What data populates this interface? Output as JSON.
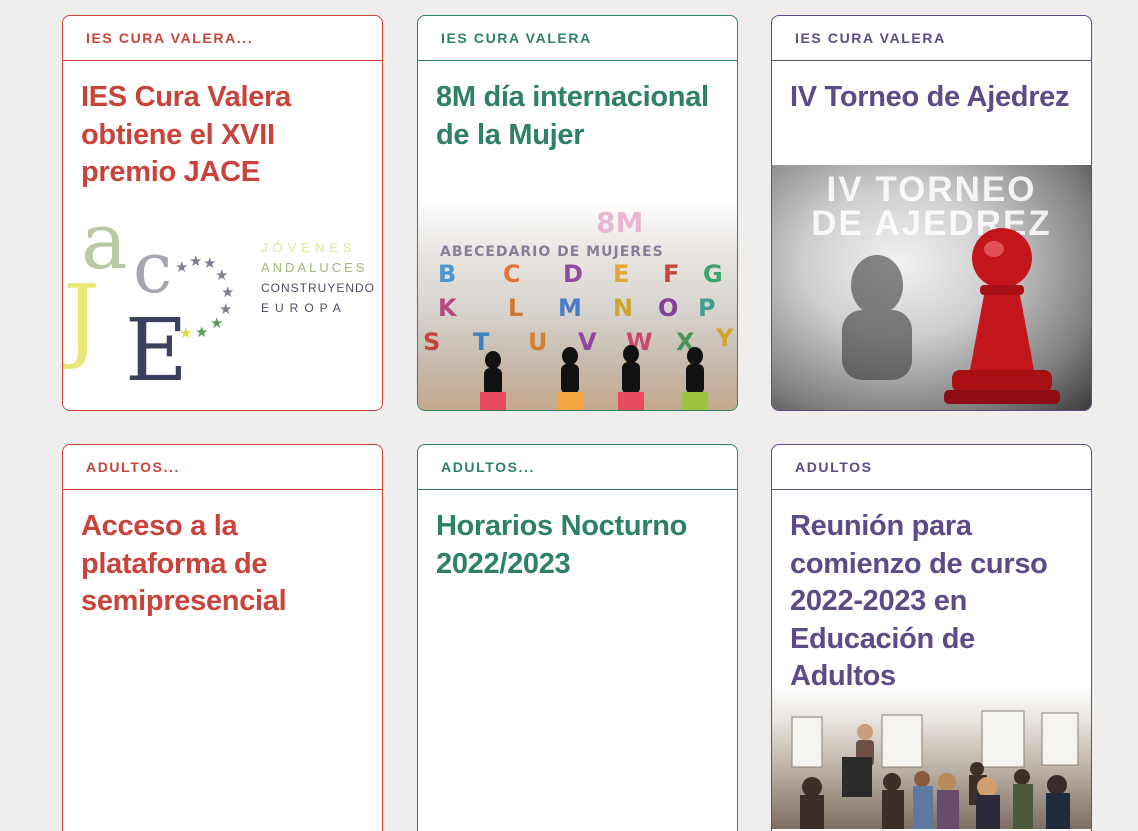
{
  "cards": [
    {
      "category": "IES CURA VALERA...",
      "title": "IES Cura Valera obtiene el XVII premio JACE",
      "image": {
        "kind": "logo",
        "letters": [
          "a",
          "c",
          "J",
          "E"
        ],
        "lines": [
          "JÓVENES",
          "ANDALUCES",
          "CONSTRUYENDO",
          "EUROPA"
        ]
      }
    },
    {
      "category": "IES CURA VALERA",
      "title": "8M día internacional de la Mujer",
      "image": {
        "kind": "photo",
        "mural_text": [
          "8M",
          "ABECEDARIO DE MUJERES"
        ]
      }
    },
    {
      "category": "IES CURA VALERA",
      "title": "IV Torneo de Ajedrez",
      "image": {
        "kind": "photo",
        "overlay_lines": [
          "IV TORNEO",
          "DE AJEDREZ"
        ]
      }
    },
    {
      "category": "ADULTOS...",
      "title": "Acceso a la plataforma de semipresencial"
    },
    {
      "category": "ADULTOS...",
      "title": "Horarios Nocturno 2022/2023"
    },
    {
      "category": "ADULTOS",
      "title": "Reunión para comienzo de curso 2022-2023 en Educación de Adultos",
      "image": {
        "kind": "photo"
      }
    }
  ],
  "colors": {
    "background": "#efeeec",
    "red": "#c9433a",
    "green": "#2e8166",
    "purple": "#5d4a86"
  }
}
